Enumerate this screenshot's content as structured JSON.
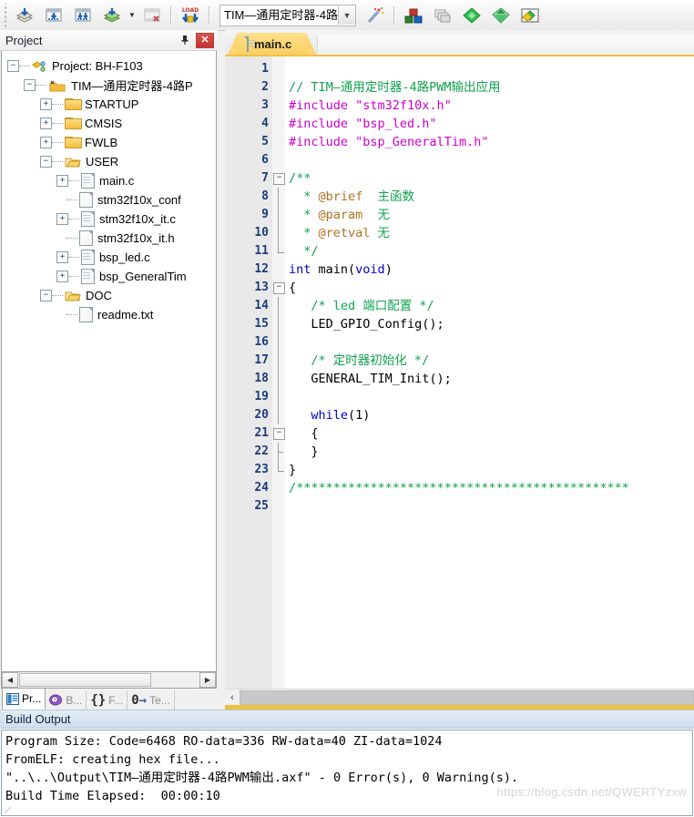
{
  "toolbar": {
    "buttons": [
      {
        "name": "translate-icon",
        "label": "Translate"
      },
      {
        "name": "build-icon",
        "label": "Build"
      },
      {
        "name": "rebuild-icon",
        "label": "Rebuild"
      },
      {
        "name": "batch-build-icon",
        "label": "Batch Build"
      },
      {
        "name": "stop-build-icon",
        "label": "Stop Build"
      },
      {
        "name": "download-icon",
        "label": "LOAD"
      }
    ],
    "project_select": {
      "value": "TIM—通用定时器-4路P",
      "title": "Select Target"
    },
    "right_buttons": [
      {
        "name": "magic-wand-icon",
        "label": "Options for Target"
      },
      {
        "name": "manage-project-items-icon",
        "label": "Manage Project Items"
      },
      {
        "name": "multi-project-icon",
        "label": "Manage Multi-Project Workspace"
      },
      {
        "name": "pack-installer-icon",
        "label": "Pack Installer"
      },
      {
        "name": "run-to-main-icon",
        "label": "Run"
      },
      {
        "name": "svcs-icon",
        "label": "Manage Components"
      }
    ]
  },
  "project_panel": {
    "title": "Project",
    "pin_tooltip": "Auto Hide",
    "close_label": "✕",
    "tree": [
      {
        "depth": 0,
        "expander": "minus",
        "icon": "project-icon",
        "label": "Project: BH-F103"
      },
      {
        "depth": 1,
        "expander": "minus",
        "icon": "target-icon",
        "label": "TIM—通用定时器-4路P"
      },
      {
        "depth": 2,
        "expander": "plus",
        "icon": "folder-icon",
        "label": "STARTUP"
      },
      {
        "depth": 2,
        "expander": "plus",
        "icon": "folder-icon",
        "label": "CMSIS"
      },
      {
        "depth": 2,
        "expander": "plus",
        "icon": "folder-icon",
        "label": "FWLB"
      },
      {
        "depth": 2,
        "expander": "minus",
        "icon": "folder-open-icon",
        "label": "USER"
      },
      {
        "depth": 3,
        "expander": "plus",
        "icon": "c-file-icon",
        "label": "main.c"
      },
      {
        "depth": 3,
        "expander": "none",
        "icon": "h-file-icon",
        "label": "stm32f10x_conf"
      },
      {
        "depth": 3,
        "expander": "plus",
        "icon": "c-file-icon",
        "label": "stm32f10x_it.c"
      },
      {
        "depth": 3,
        "expander": "none",
        "icon": "h-file-icon",
        "label": "stm32f10x_it.h"
      },
      {
        "depth": 3,
        "expander": "plus",
        "icon": "c-file-icon",
        "label": "bsp_led.c"
      },
      {
        "depth": 3,
        "expander": "plus",
        "icon": "c-file-icon",
        "label": "bsp_GeneralTim"
      },
      {
        "depth": 2,
        "expander": "minus",
        "icon": "folder-open-icon",
        "label": "DOC"
      },
      {
        "depth": 3,
        "expander": "none",
        "icon": "txt-file-icon",
        "label": "readme.txt"
      }
    ],
    "hscroll": {
      "left_arrow": "◀",
      "right_arrow": "▶"
    },
    "bottom_tabs": [
      {
        "name": "tab-project",
        "icon": "project-tab-icon",
        "label": "Pr...",
        "active": true
      },
      {
        "name": "tab-books",
        "icon": "books-tab-icon",
        "label": "B...",
        "active": false
      },
      {
        "name": "tab-functions",
        "icon": "braces-icon",
        "label": "F...",
        "prefix": "{}",
        "active": false
      },
      {
        "name": "tab-templates",
        "icon": "templates-icon",
        "label": "Te...",
        "prefix": "0",
        "active": false
      }
    ]
  },
  "editor": {
    "tabs": [
      {
        "label": "main.c",
        "icon": "c-file-icon",
        "active": true
      }
    ],
    "lines": [
      {
        "n": "1",
        "fold": "none",
        "segs": []
      },
      {
        "n": "2",
        "fold": "none",
        "segs": [
          {
            "t": "// TIM—通用定时器-4路PWM输出应用",
            "c": "cmt"
          }
        ]
      },
      {
        "n": "3",
        "fold": "none",
        "segs": [
          {
            "t": "#include ",
            "c": "pre"
          },
          {
            "t": "\"stm32f10x.h\"",
            "c": "str"
          }
        ]
      },
      {
        "n": "4",
        "fold": "none",
        "segs": [
          {
            "t": "#include ",
            "c": "pre"
          },
          {
            "t": "\"bsp_led.h\"",
            "c": "str"
          }
        ]
      },
      {
        "n": "5",
        "fold": "none",
        "segs": [
          {
            "t": "#include ",
            "c": "pre"
          },
          {
            "t": "\"bsp_GeneralTim.h\"",
            "c": "str"
          }
        ]
      },
      {
        "n": "6",
        "fold": "none",
        "segs": []
      },
      {
        "n": "7",
        "fold": "start",
        "segs": [
          {
            "t": "/**",
            "c": "cmt"
          }
        ]
      },
      {
        "n": "8",
        "fold": "line",
        "segs": [
          {
            "t": "  * ",
            "c": "cmt"
          },
          {
            "t": "@brief",
            "c": "dox"
          },
          {
            "t": "  主函数",
            "c": "cmt"
          }
        ]
      },
      {
        "n": "9",
        "fold": "line",
        "segs": [
          {
            "t": "  * ",
            "c": "cmt"
          },
          {
            "t": "@param",
            "c": "dox"
          },
          {
            "t": "  无",
            "c": "cmt"
          }
        ]
      },
      {
        "n": "10",
        "fold": "line",
        "segs": [
          {
            "t": "  * ",
            "c": "cmt"
          },
          {
            "t": "@retval",
            "c": "dox"
          },
          {
            "t": " 无",
            "c": "cmt"
          }
        ]
      },
      {
        "n": "11",
        "fold": "end",
        "segs": [
          {
            "t": "  */",
            "c": "cmt"
          }
        ]
      },
      {
        "n": "12",
        "fold": "none",
        "segs": [
          {
            "t": "int",
            "c": "k"
          },
          {
            "t": " main(",
            "c": ""
          },
          {
            "t": "void",
            "c": "k"
          },
          {
            "t": ")",
            "c": ""
          }
        ]
      },
      {
        "n": "13",
        "fold": "start",
        "segs": [
          {
            "t": "{",
            "c": ""
          }
        ]
      },
      {
        "n": "14",
        "fold": "line",
        "segs": [
          {
            "t": "   /* led 端口配置 */",
            "c": "cmt"
          }
        ]
      },
      {
        "n": "15",
        "fold": "line",
        "segs": [
          {
            "t": "   LED_GPIO_Config();",
            "c": ""
          }
        ]
      },
      {
        "n": "16",
        "fold": "line",
        "segs": []
      },
      {
        "n": "17",
        "fold": "line",
        "segs": [
          {
            "t": "   /* 定时器初始化 */",
            "c": "cmt"
          }
        ]
      },
      {
        "n": "18",
        "fold": "line",
        "segs": [
          {
            "t": "   GENERAL_TIM_Init();",
            "c": ""
          }
        ]
      },
      {
        "n": "19",
        "fold": "line",
        "segs": []
      },
      {
        "n": "20",
        "fold": "line",
        "segs": [
          {
            "t": "   ",
            "c": ""
          },
          {
            "t": "while",
            "c": "k"
          },
          {
            "t": "(1)",
            "c": ""
          }
        ]
      },
      {
        "n": "21",
        "fold": "start2",
        "segs": [
          {
            "t": "   {",
            "c": ""
          }
        ]
      },
      {
        "n": "22",
        "fold": "end2",
        "segs": [
          {
            "t": "   }",
            "c": ""
          }
        ]
      },
      {
        "n": "23",
        "fold": "end",
        "segs": [
          {
            "t": "}",
            "c": ""
          }
        ]
      },
      {
        "n": "24",
        "fold": "none",
        "segs": [
          {
            "t": "/",
            "c": "cmt"
          },
          {
            "t": "*********************************************",
            "c": "cmt"
          }
        ]
      },
      {
        "n": "25",
        "fold": "none",
        "segs": []
      }
    ],
    "hscroll": {
      "left_arrow": "‹"
    }
  },
  "build_output": {
    "title": "Build Output",
    "lines": [
      "Program Size: Code=6468 RO-data=336 RW-data=40 ZI-data=1024",
      "FromELF: creating hex file...",
      "\"..\\..\\Output\\TIM—通用定时器-4路PWM输出.axf\" - 0 Error(s), 0 Warning(s).",
      "Build Time Elapsed:  00:00:10"
    ],
    "watermark": "https://blog.csdn.net/QWERTYzxw"
  },
  "colors": {
    "comment": "#12a050",
    "keyword": "#0000cd",
    "preprocessor": "#cc00cc",
    "doxygen": "#b07020",
    "tab_accent": "#f0c040",
    "line_number": "#1d3c7a"
  }
}
